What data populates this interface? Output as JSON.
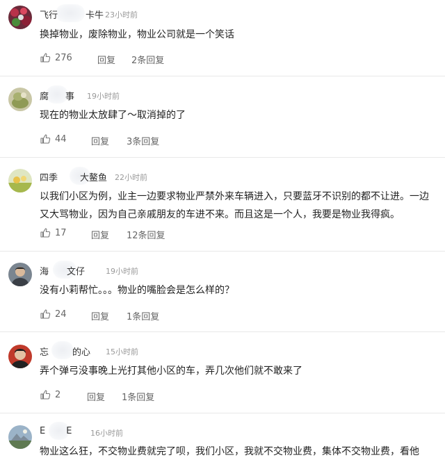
{
  "comments": [
    {
      "username": "飞行",
      "username_tail": "卡牛",
      "time": "23小时前",
      "text": "换掉物业，废除物业，物业公司就是一个笑话",
      "likes": "276",
      "reply_label": "回复",
      "replies_label": "2条回复",
      "avatar_icon": "avatar-berries-icon"
    },
    {
      "username": "腐",
      "username_tail": "事",
      "time": "19小时前",
      "text": "现在的物业太放肆了～取消掉的了",
      "likes": "44",
      "reply_label": "回复",
      "replies_label": "3条回复",
      "avatar_icon": "avatar-plant-icon"
    },
    {
      "username": "四季",
      "username_tail": "大鳌鱼",
      "time": "22小时前",
      "text": "以我们小区为例，业主一边要求物业严禁外来车辆进入，只要蓝牙不识别的都不让进。一边又大骂物业，因为自己亲戚朋友的车进不来。而且这是一个人，我要是物业我得疯。",
      "likes": "17",
      "reply_label": "回复",
      "replies_label": "12条回复",
      "avatar_icon": "avatar-field-icon"
    },
    {
      "username": "海",
      "username_tail": "文仔",
      "time": "19小时前",
      "text": "没有小莉帮忙。。。物业的嘴脸会是怎么样的？",
      "likes": "24",
      "reply_label": "回复",
      "replies_label": "1条回复",
      "avatar_icon": "avatar-person-icon"
    },
    {
      "username": "忘",
      "username_tail": "的心",
      "time": "15小时前",
      "text": "弄个弹弓没事晚上光打其他小区的车，弄几次他们就不敢来了",
      "likes": "2",
      "reply_label": "回复",
      "replies_label": "1条回复",
      "avatar_icon": "avatar-portrait-icon"
    },
    {
      "username": "E",
      "username_tail": "E",
      "time": "16小时前",
      "text": "物业这么狂，不交物业费就完了呗，我们小区，我就不交物业费，集体不交物业费，看他",
      "likes": "",
      "reply_label": "",
      "replies_label": "",
      "avatar_icon": "avatar-landscape-icon"
    }
  ],
  "colors": {
    "text": "#222222",
    "meta": "#999999",
    "action": "#666666",
    "divider": "#e8e8e8"
  }
}
